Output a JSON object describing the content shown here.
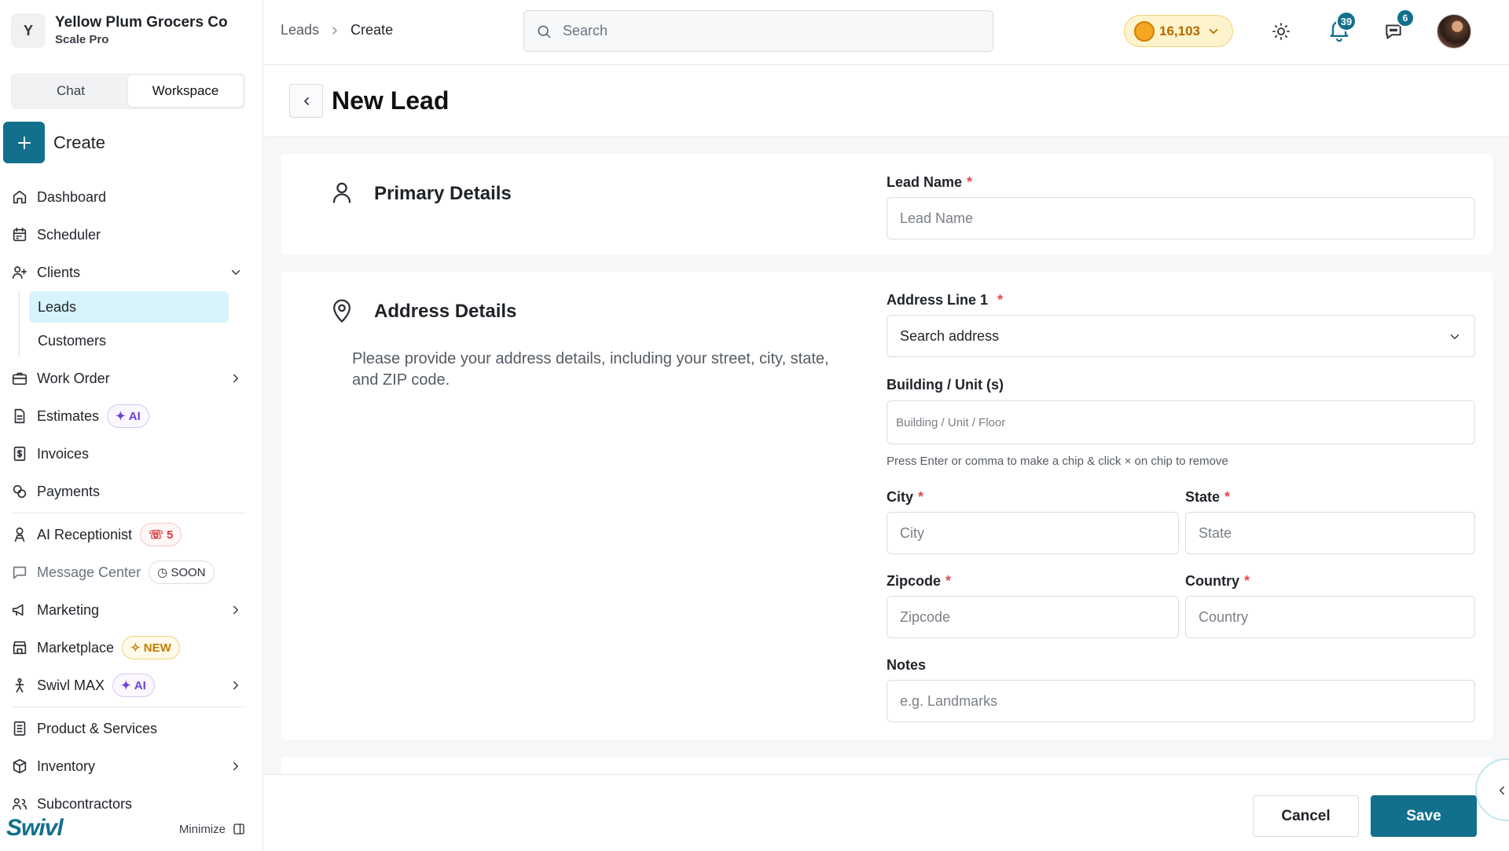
{
  "org": {
    "initial": "Y",
    "name": "Yellow Plum Grocers Co",
    "plan": "Scale Pro"
  },
  "mode_tabs": [
    {
      "label": "Chat"
    },
    {
      "label": "Workspace",
      "active": true
    }
  ],
  "create_label": "Create",
  "nav": {
    "dashboard": "Dashboard",
    "scheduler": "Scheduler",
    "clients": "Clients",
    "leads": "Leads",
    "customers": "Customers",
    "work_order": "Work Order",
    "estimates": "Estimates",
    "estimates_badge": "AI",
    "invoices": "Invoices",
    "payments": "Payments",
    "ai_receptionist": "AI Receptionist",
    "ai_receptionist_badge": "5",
    "message_center": "Message Center",
    "message_center_badge": "SOON",
    "marketing": "Marketing",
    "marketplace": "Marketplace",
    "marketplace_badge": "NEW",
    "swivl_max": "Swivl MAX",
    "swivl_max_badge": "AI",
    "products_services": "Product & Services",
    "inventory": "Inventory",
    "subcontractors": "Subcontractors"
  },
  "footer": {
    "logo": "Swivl",
    "minimize": "Minimize"
  },
  "breadcrumb": {
    "parent": "Leads",
    "current": "Create"
  },
  "search": {
    "placeholder": "Search"
  },
  "credits": "16,103",
  "notifications_count": "39",
  "messages_count": "6",
  "page_title": "New Lead",
  "primary": {
    "title": "Primary Details",
    "lead_name_label": "Lead Name",
    "lead_name_placeholder": "Lead Name"
  },
  "address": {
    "title": "Address Details",
    "description": "Please provide your address details, including your street, city, state, and ZIP code.",
    "line1_label": "Address Line 1",
    "line1_value": "Search address",
    "building_label": "Building / Unit (s)",
    "building_placeholder": "Building / Unit / Floor",
    "building_hint": "Press Enter or comma to make a chip & click × on chip to remove",
    "city_label": "City",
    "city_placeholder": "City",
    "state_label": "State",
    "state_placeholder": "State",
    "zip_label": "Zipcode",
    "zip_placeholder": "Zipcode",
    "country_label": "Country",
    "country_placeholder": "Country",
    "notes_label": "Notes",
    "notes_placeholder": "e.g. Landmarks"
  },
  "actions": {
    "cancel": "Cancel",
    "save": "Save"
  },
  "colors": {
    "accent": "#12708c",
    "active_nav": "#d7f3fb",
    "required": "#e5484d"
  }
}
